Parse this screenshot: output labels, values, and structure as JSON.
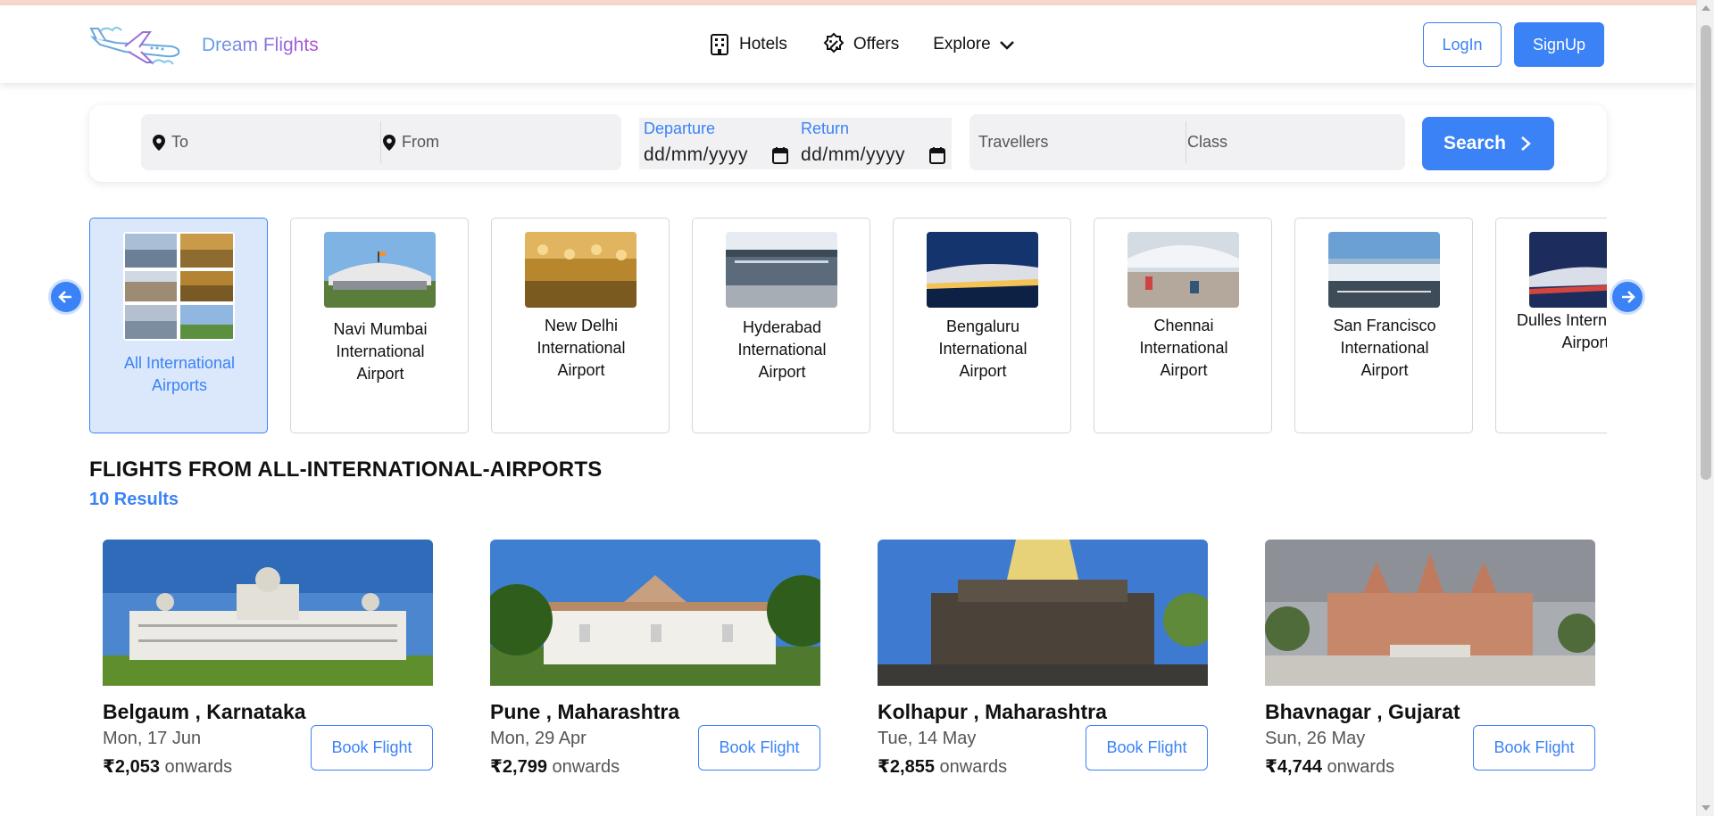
{
  "brand": {
    "name": "Dream Flights"
  },
  "nav": {
    "hotels": "Hotels",
    "offers": "Offers",
    "explore": "Explore"
  },
  "auth": {
    "login": "LogIn",
    "signup": "SignUp"
  },
  "search": {
    "to_placeholder": "To",
    "from_placeholder": "From",
    "departure_label": "Departure",
    "departure_value": "dd/mm/yyyy",
    "return_label": "Return",
    "return_value": "dd/mm/yyyy",
    "travellers_placeholder": "Travellers",
    "class_placeholder": "Class",
    "search_label": "Search"
  },
  "airports": [
    {
      "name": "All International\nAirports",
      "active": true,
      "icon": "airport-collage"
    },
    {
      "name": "Navi Mumbai\nInternational\nAirport",
      "icon": "airport-photo"
    },
    {
      "name": "New Delhi\nInternational\nAirport",
      "icon": "airport-photo"
    },
    {
      "name": "Hyderabad\nInternational\nAirport",
      "icon": "airport-photo"
    },
    {
      "name": "Bengaluru\nInternational\nAirport",
      "icon": "airport-photo"
    },
    {
      "name": "Chennai\nInternational\nAirport",
      "icon": "airport-photo"
    },
    {
      "name": "San Francisco\nInternational\nAirport",
      "icon": "airport-photo"
    },
    {
      "name": "Dulles International\nAirport",
      "icon": "airport-photo"
    }
  ],
  "results": {
    "title": "FLIGHTS FROM ALL-INTERNATIONAL-AIRPORTS",
    "count": "10 Results",
    "cards": [
      {
        "city": "Belgaum , Karnataka",
        "date": "Mon, 17 Jun",
        "price": "₹2,053",
        "suffix": " onwards",
        "button": "Book Flight"
      },
      {
        "city": "Pune , Maharashtra",
        "date": "Mon, 29 Apr",
        "price": "₹2,799",
        "suffix": " onwards",
        "button": "Book Flight"
      },
      {
        "city": "Kolhapur , Maharashtra",
        "date": "Tue, 14 May",
        "price": "₹2,855",
        "suffix": " onwards",
        "button": "Book Flight"
      },
      {
        "city": "Bhavnagar , Gujarat",
        "date": "Sun, 26 May",
        "price": "₹4,744",
        "suffix": " onwards",
        "button": "Book Flight"
      }
    ]
  },
  "colors": {
    "accent": "#3b82f6",
    "active_bg": "#dbe8fb"
  }
}
